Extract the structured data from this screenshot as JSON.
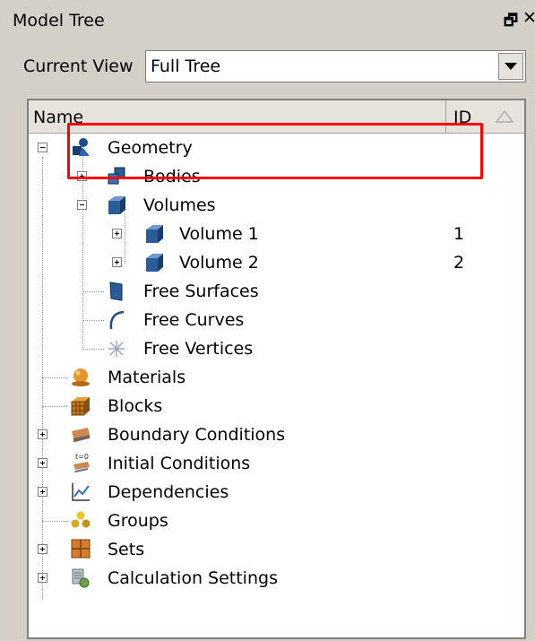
{
  "panel": {
    "title": "Model Tree"
  },
  "current_view": {
    "label": "Current View",
    "value": "Full Tree"
  },
  "columns": {
    "name": "Name",
    "id": "ID"
  },
  "tree": {
    "geometry": "Geometry",
    "bodies": "Bodies",
    "volumes": "Volumes",
    "volume1": {
      "label": "Volume 1",
      "id": "1"
    },
    "volume2": {
      "label": "Volume 2",
      "id": "2"
    },
    "free_surfaces": "Free Surfaces",
    "free_curves": "Free Curves",
    "free_vertices": "Free Vertices",
    "materials": "Materials",
    "blocks": "Blocks",
    "boundary_conditions": "Boundary Conditions",
    "initial_conditions": "Initial Conditions",
    "dependencies": "Dependencies",
    "groups": "Groups",
    "sets": "Sets",
    "calculation_settings": "Calculation Settings"
  },
  "colors": {
    "highlight": "#ff0000",
    "panel_bg": "#d4d0c8",
    "tree_bg": "#ffffff"
  }
}
